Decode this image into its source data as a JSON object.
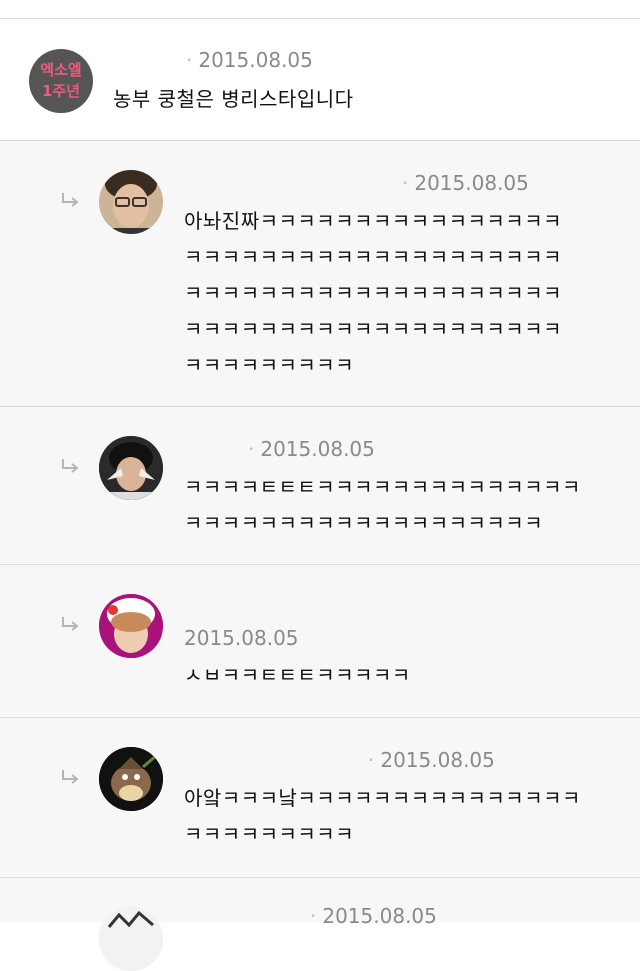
{
  "comments": [
    {
      "avatar": {
        "name": "exo-l-avatar",
        "line1": "엑소엘",
        "line2": "1주년"
      },
      "date": "2015.08.05",
      "text": "농부 쿵철은 병리스타입니다"
    },
    {
      "date": "2015.08.05",
      "text": "아놔진짜ㅋㅋㅋㅋㅋㅋㅋㅋㅋㅋㅋㅋㅋㅋㅋㅋ\nㅋㅋㅋㅋㅋㅋㅋㅋㅋㅋㅋㅋㅋㅋㅋㅋㅋㅋㅋㅋ\nㅋㅋㅋㅋㅋㅋㅋㅋㅋㅋㅋㅋㅋㅋㅋㅋㅋㅋㅋㅋ\nㅋㅋㅋㅋㅋㅋㅋㅋㅋㅋㅋㅋㅋㅋㅋㅋㅋㅋㅋㅋ\nㅋㅋㅋㅋㅋㅋㅋㅋㅋ"
    },
    {
      "date": "2015.08.05",
      "text": "ㅋㅋㅋㅋㅌㅌㅌㅋㅋㅋㅋㅋㅋㅋㅋㅋㅋㅋㅋㅋㅋ\nㅋㅋㅋㅋㅋㅋㅋㅋㅋㅋㅋㅋㅋㅋㅋㅋㅋㅋㅋ"
    },
    {
      "date": "2015.08.05",
      "text": "ㅅㅂㅋㅋㅌㅌㅌㅋㅋㅋㅋㅋ"
    },
    {
      "date": "2015.08.05",
      "text": "아앜ㅋㅋㅋ낰ㅋㅋㅋㅋㅋㅋㅋㅋㅋㅋㅋㅋㅋㅋㅋ\nㅋㅋㅋㅋㅋㅋㅋㅋㅋ"
    },
    {
      "date": "2015.08.05",
      "text": ""
    }
  ],
  "colors": {
    "accent_text": "#f05a7e",
    "meta": "#8a8a8a",
    "reply_bg": "#f7f7f7"
  }
}
